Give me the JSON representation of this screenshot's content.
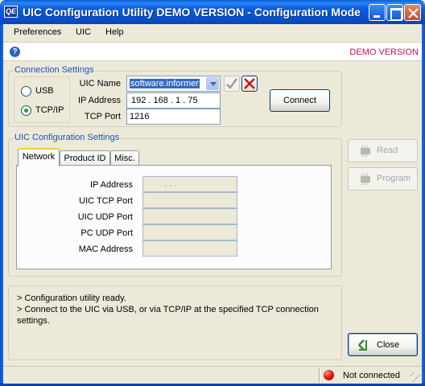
{
  "window": {
    "title": "UIC Configuration Utility DEMO VERSION - Configuration Mode",
    "app_icon_text": "QE"
  },
  "menu": [
    "Preferences",
    "UIC",
    "Help"
  ],
  "toolbar": {
    "demo_label": "DEMO VERSION",
    "help_icon": "?"
  },
  "connection": {
    "group_title": "Connection Settings",
    "radio_usb": "USB",
    "radio_tcpip": "TCP/IP",
    "selected": "TCP/IP",
    "uic_name_label": "UIC Name",
    "uic_name_value": "software.informer",
    "ip_label": "IP Address",
    "ip_value": "192 . 168 .  1  . 75",
    "port_label": "TCP Port",
    "port_value": "1216",
    "connect_label": "Connect",
    "check_icon": "checkmark-icon",
    "delete_icon": "red-x-icon"
  },
  "config": {
    "group_title": "UIC Configuration Settings",
    "tabs": [
      "Network",
      "Product ID",
      "Misc."
    ],
    "active_tab": "Network",
    "fields": {
      "ip": "IP Address",
      "tcp_port": "UIC TCP Port",
      "udp_port": "UIC UDP Port",
      "pc_udp_port": "PC UDP Port",
      "mac": "MAC Address"
    },
    "ip_dots": ".        .        ."
  },
  "side_buttons": {
    "read": "Read",
    "program": "Program",
    "close": "Close"
  },
  "log": {
    "line1": "> Configuration utility ready.",
    "line2": "> Connect to the UIC via USB, or via TCP/IP at the specified TCP connection",
    "line3": "settings."
  },
  "status": {
    "text": "Not connected",
    "led_color": "#e52010"
  },
  "colors": {
    "group_title": "#1f4fc0",
    "demo": "#c0105a",
    "titlebar": "#0a53d0"
  }
}
